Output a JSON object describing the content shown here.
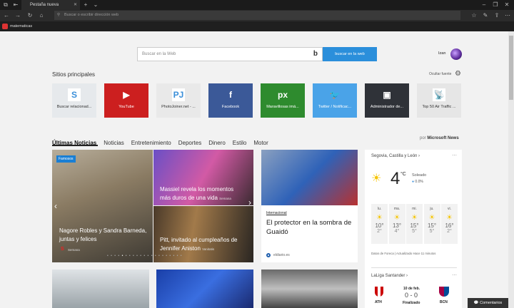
{
  "browser": {
    "tab_title": "Pestaña nueva",
    "address_placeholder": "Buscar o escribir dirección web",
    "favorite": "matematicas"
  },
  "search": {
    "placeholder": "Buscar en la Web",
    "button": "buscar en la web"
  },
  "user": {
    "name": "Izan"
  },
  "top_sites": {
    "title": "Sitios principales",
    "hide_label": "Ocultar fuente",
    "tiles": [
      {
        "label": "Buscar relacionad...",
        "color": "#e6e9ec",
        "icon": "S"
      },
      {
        "label": "YouTube",
        "color": "#cc1f1f",
        "icon": "▶"
      },
      {
        "label": "PhotoJoiner.net - ...",
        "color": "#e9e9e9",
        "icon": "PJ"
      },
      {
        "label": "Facebook",
        "color": "#3b5998",
        "icon": "f"
      },
      {
        "label": "Maravillosas imá...",
        "color": "#2e8b2e",
        "icon": "px"
      },
      {
        "label": "Twitter / Notificac...",
        "color": "#4aa3e8",
        "icon": "🐦"
      },
      {
        "label": "Administrador de...",
        "color": "#2f3238",
        "icon": "▣"
      },
      {
        "label": "Top 50 Air Traffic ...",
        "color": "#e6e6e6",
        "icon": "📡"
      }
    ]
  },
  "news_tabs": [
    "Últimas Noticias",
    "Noticias",
    "Entretenimiento",
    "Deportes",
    "Dinero",
    "Estilo",
    "Motor"
  ],
  "news_source": {
    "prefix": "por",
    "name": "Microsoft News"
  },
  "carousel": {
    "badge": "Famosos",
    "main": {
      "title": "Nagore Robles y Sandra Barneda, juntas y felices",
      "source": "Semana"
    },
    "top_right": {
      "title": "Massiel revela los momentos más duros de una vida",
      "source": "Semana"
    },
    "bottom_right": {
      "title": "Pitt, invitado al cumpleaños de Jennifer Aniston",
      "source": "Vanitatis"
    }
  },
  "feature": {
    "category": "Internacional",
    "title": "El protector en la sombra de Guaidó",
    "source": "eldiario.es"
  },
  "weather": {
    "location": "Segovia, Castilla y León",
    "temp": "4",
    "unit": "°C",
    "condition": "Soleado",
    "precip": "0.0%",
    "days": [
      {
        "d": "lu.",
        "h": "10°",
        "l": "2°"
      },
      {
        "d": "ma.",
        "h": "13°",
        "l": "4°"
      },
      {
        "d": "mi.",
        "h": "15°",
        "l": "5°"
      },
      {
        "d": "ju.",
        "h": "15°",
        "l": "5°"
      },
      {
        "d": "vi.",
        "h": "16°",
        "l": "2°"
      }
    ],
    "footer": "Datos de Foreca | Actualizado Hace 11 minutos"
  },
  "sports": {
    "league": "LaLiga Santander",
    "date": "10 de feb.",
    "score": "0 - 0",
    "status": "Finalizado",
    "home": "ATH",
    "away": "BCN"
  },
  "feedback": "Comentarios"
}
